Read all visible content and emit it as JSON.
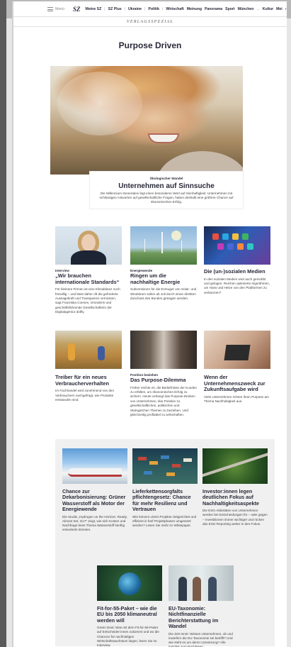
{
  "nav": {
    "menu_label": "Menü",
    "logo": "SZ",
    "links": [
      "Meine SZ",
      "SZ Plus",
      "Ukraine",
      "Politik",
      "Wirtschaft",
      "Meinung",
      "Panorama",
      "Sport",
      "München",
      "Kultur",
      "Mei"
    ],
    "more_icon": "chevron-right-icon"
  },
  "verlag": "VERLAGSSPEZIAL",
  "page_title": "Purpose Driven",
  "hero": {
    "kicker": "Ökologischer Wandel",
    "title": "Unternehmen auf Sinnsuche",
    "text": "Die Millennium-Generation legt einen besonderen Wert auf Sinnhaftigkeit. Unternehmen mit schlüssigen Antworten auf gesellschaftliche Fragen, haben deshalb eine größere Chance auf ökonomischen Erfolg."
  },
  "row1": [
    {
      "kicker": "Interview",
      "title": "„Wir brauchen internationale Standards“",
      "text": "Für kleinere Firmen ist eine Klimabilanz noch freiwillig – und lässt daher oft die geforderte Aussagekraft und Transparenz vermissen, sagt Franziska Coenen, Gründerin und geschäftsführende Gesellschafterin der Digitalagentur dotfly."
    },
    {
      "kicker": "Energiewende",
      "title": "Ringen um die nachhaltige Energie",
      "text": "Subventionen für die Erzeuger von Solar- und Windstrom sollen ab Juli durch einen direkten Zuschuss des Bundes getragen werden."
    },
    {
      "kicker": "",
      "title": "Die (un-)sozialen Medien",
      "text": "In den sozialen Medien wird auch gemobbt und gelogen. Reichen optimierte Algorithmen, um Hass und Hetze von den Plattformen zu verbannen?"
    }
  ],
  "row2": [
    {
      "kicker": "",
      "title": "Treiber für ein neues Verbraucherverhalten",
      "text": "Im Fachhandel wird zunehmend von den Verbrauchern nachgefragt, wie Produkte entstanden sind."
    },
    {
      "kicker": "Position beziehen",
      "title": "Das Purpose-Dilemma",
      "text": "Früher reichte es, die Bedürfnisse der Kunden zu erfüllen, um ökonomischen Erfolg zu sichern. Heute verlangt das Purpose-Denken von Unternehmen, klar Position zu gesellschaftlichen, politischen und ökologischen Themen zu beziehen. Und gleichzeitig profitabel zu wirtschaften."
    },
    {
      "kicker": "",
      "title": "Wenn der Unternehmenszweck zur Zukunftsaufgabe wird",
      "text": "Viele Unternehmen richten ihren Purpose am Thema Nachhaltigkeit aus."
    }
  ],
  "gray": [
    {
      "title": "Chance zur Dekarbonisierung: Grüner Wasserstoff als Motor der Energiewende",
      "text": "Die Studie „Hydrogen on the Horizon: Ready, Almost Set, Go?“ zeigt, wie sich Kosten und Nachfrage beim Thema Wasserstoff künftig entwickeln könnten."
    },
    {
      "title": "Lieferkettensorgfalts pflichtengesetz: Chance für mehr Resilienz und Vertrauen",
      "text": "Wie können LkSG-Projekte zielgerichtet und effizient in fünf Projektphasen umgesetzt werden? Lesen Sie mehr im Whitepaper."
    },
    {
      "title": "Investor:innen legen deutlichen Fokus auf Nachhaltigkeitsaspekte",
      "text": "Die ESG-Aktivitäten von Unternehmen werden bei Entscheidungen für – oder gegen – Investitionen immer wichtiger und rücken das ESG-Reporting weiter in den Fokus."
    },
    {
      "title": "Fit-for-55-Paket – wie die EU bis 2050 klimaneutral werden will",
      "text": "Green Deal: Was mit dem Fit-for-55-Paket auf Entscheider:innen zukommt und wo die Chancen für nachhaltiges Wirtschaftswachstum liegen, lesen Sie im Interview."
    },
    {
      "title": "EU-Taxonomie: Nichtfinanzielle Berichterstattung im Wandel",
      "text": "Die Zeit rennt: Wissen Unternehmen, ob und inwiefern die EU-Taxonomie sie betrifft? Und wie steht es um deren Umsetzung? Alle Insights zum Nachlesen."
    }
  ]
}
